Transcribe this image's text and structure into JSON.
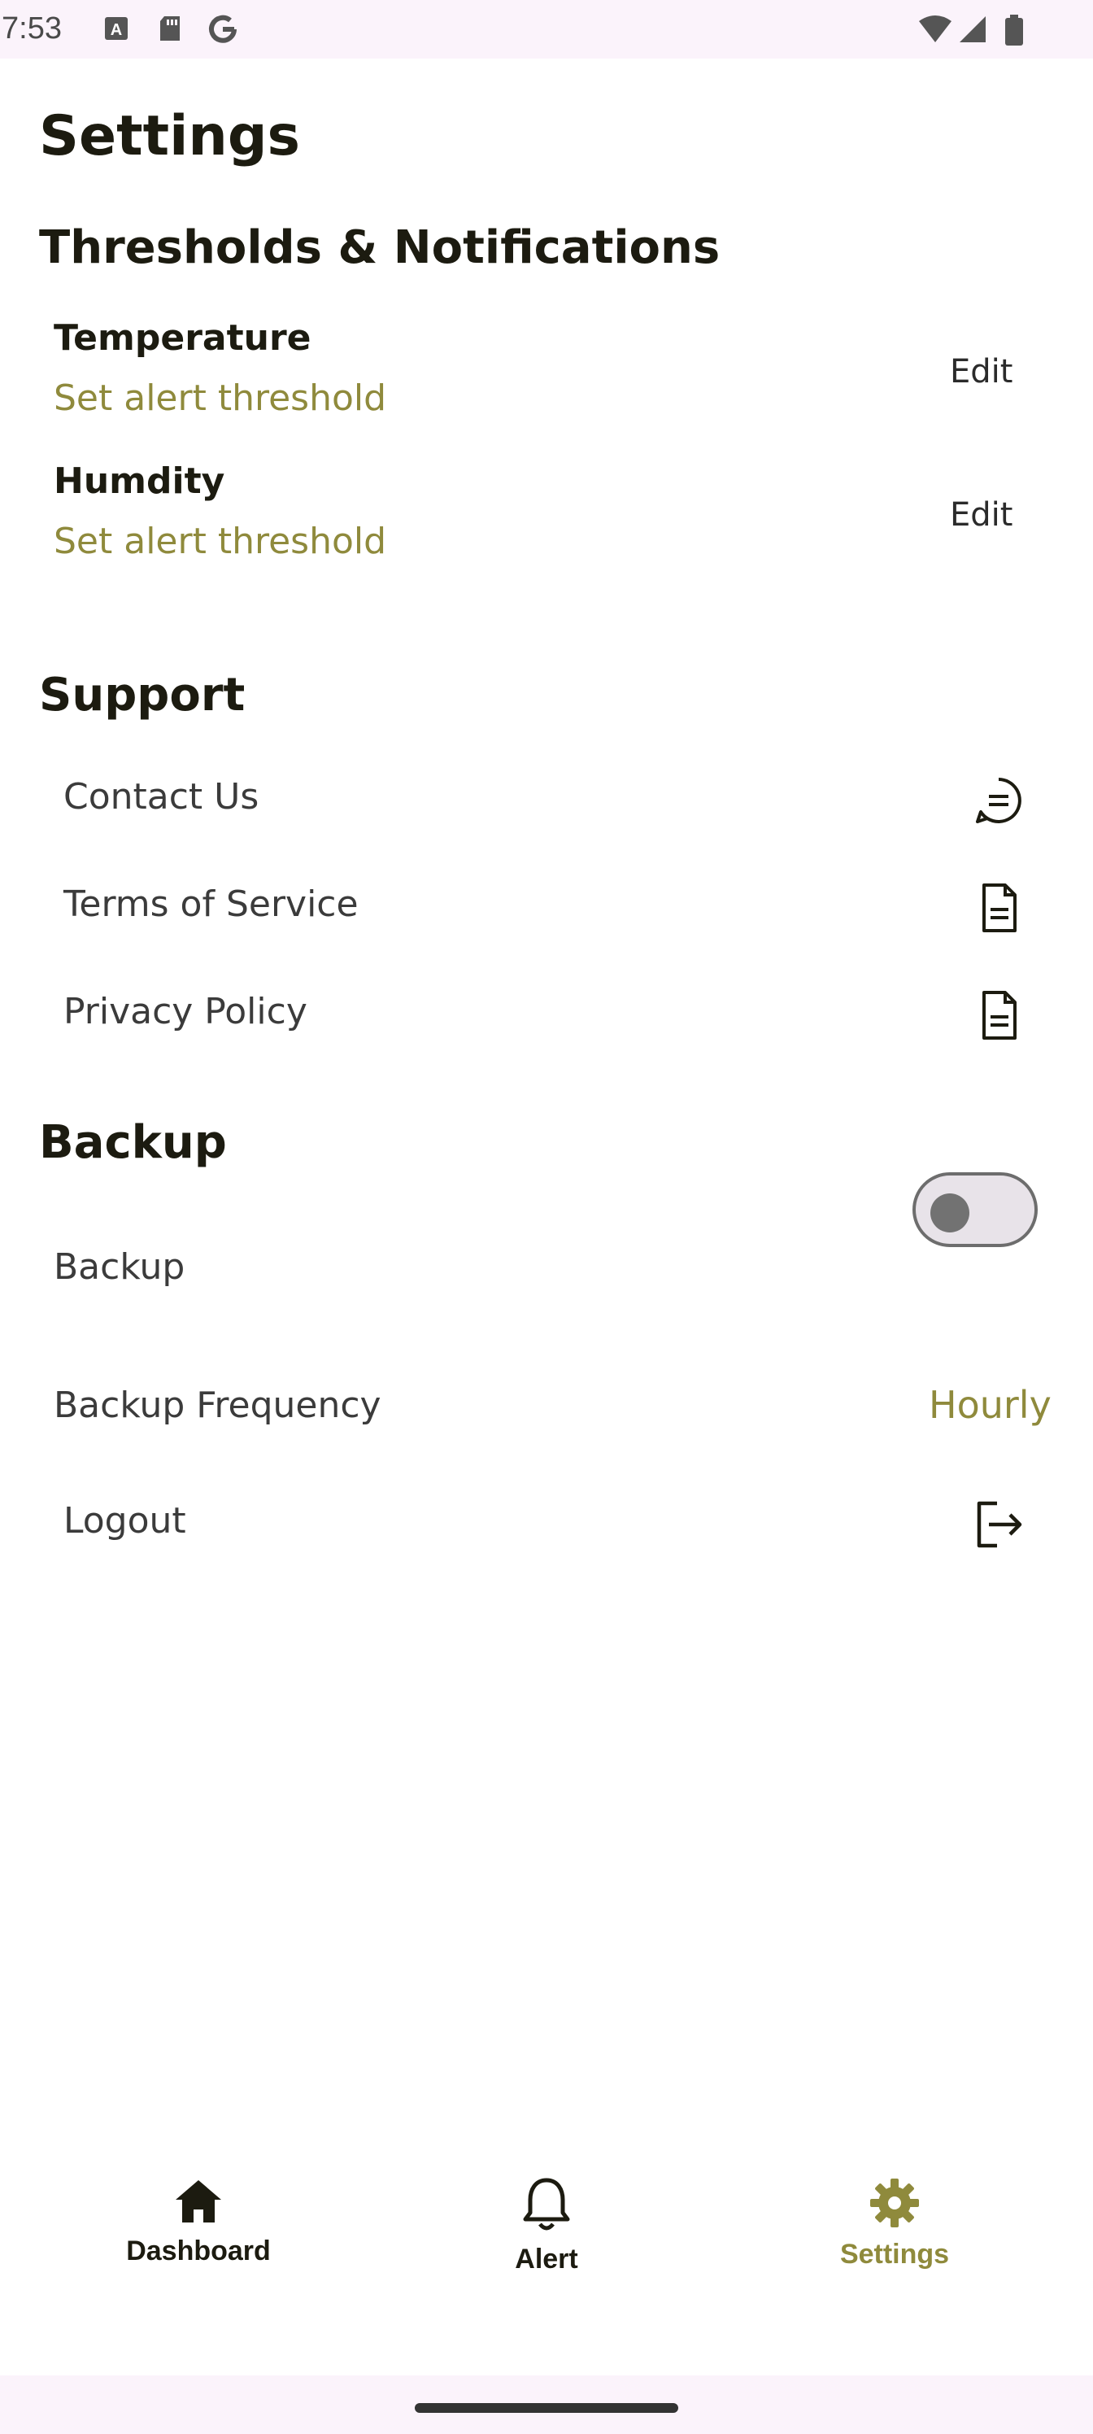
{
  "status_bar": {
    "time": "7:53",
    "left_icons": [
      "text-a-icon",
      "sd-card-icon",
      "google-icon"
    ],
    "right_icons": [
      "wifi-icon",
      "signal-icon",
      "battery-icon"
    ]
  },
  "page_title": "Settings",
  "thresholds": {
    "heading": "Thresholds & Notifications",
    "items": [
      {
        "title": "Temperature",
        "subtitle": "Set alert threshold",
        "action": "Edit"
      },
      {
        "title": "Humdity",
        "subtitle": "Set alert threshold",
        "action": "Edit"
      }
    ]
  },
  "support": {
    "heading": "Support",
    "items": [
      {
        "label": "Contact Us",
        "icon": "chat-icon"
      },
      {
        "label": "Terms of Service",
        "icon": "document-icon"
      },
      {
        "label": "Privacy Policy",
        "icon": "document-icon"
      }
    ]
  },
  "backup": {
    "heading": "Backup",
    "toggle_label": "Backup",
    "toggle_on": false,
    "frequency_label": "Backup Frequency",
    "frequency_value": "Hourly"
  },
  "logout": {
    "label": "Logout",
    "icon": "logout-icon"
  },
  "bottom_nav": {
    "items": [
      {
        "label": "Dashboard",
        "icon": "home-icon",
        "active": false
      },
      {
        "label": "Alert",
        "icon": "bell-icon",
        "active": false
      },
      {
        "label": "Settings",
        "icon": "gear-icon",
        "active": true
      }
    ]
  },
  "colors": {
    "accent": "#8f8a3c",
    "text_primary": "#1c1b10",
    "status_bar_bg": "#fbf3fb"
  }
}
